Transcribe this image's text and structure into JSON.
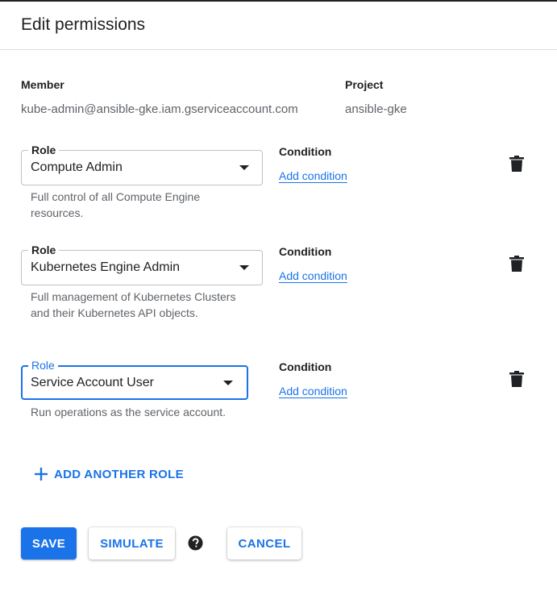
{
  "dialog": {
    "title": "Edit permissions"
  },
  "member": {
    "label": "Member",
    "value": "kube-admin@ansible-gke.iam.gserviceaccount.com"
  },
  "project": {
    "label": "Project",
    "value": "ansible-gke"
  },
  "roles": [
    {
      "legend": "Role",
      "value": "Compute Admin",
      "description": "Full control of all Compute Engine resources.",
      "condition_label": "Condition",
      "condition_link": "Add condition"
    },
    {
      "legend": "Role",
      "value": "Kubernetes Engine Admin",
      "description": "Full management of Kubernetes Clusters and their Kubernetes API objects.",
      "condition_label": "Condition",
      "condition_link": "Add condition"
    },
    {
      "legend": "Role",
      "value": "Service Account User",
      "description": "Run operations as the service account.",
      "condition_label": "Condition",
      "condition_link": "Add condition",
      "focused": true
    }
  ],
  "add_role": {
    "label": "ADD ANOTHER ROLE",
    "icon": "plus-icon"
  },
  "actions": {
    "save": "SAVE",
    "simulate": "SIMULATE",
    "help_icon": "help-circle-icon",
    "cancel": "CANCEL"
  },
  "colors": {
    "accent": "#1a73e8",
    "text": "#202124",
    "muted": "#5f6368",
    "border": "#bdc1c6"
  }
}
